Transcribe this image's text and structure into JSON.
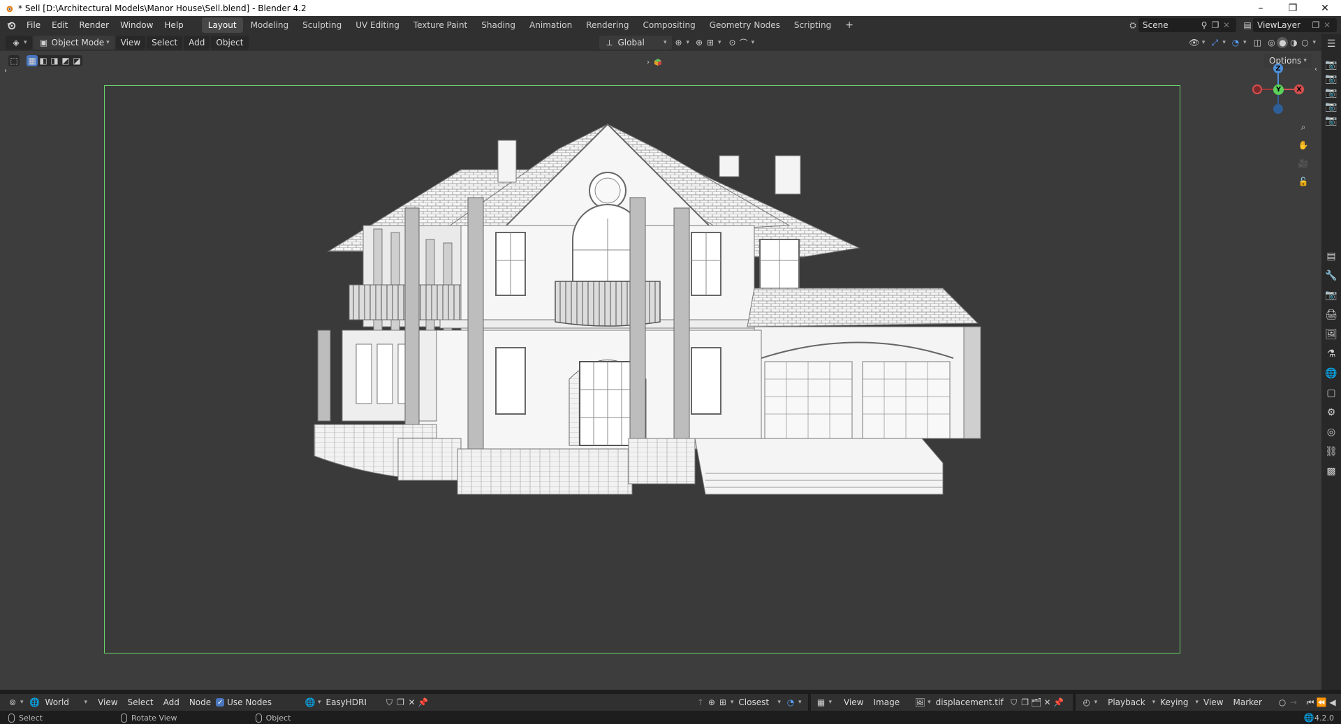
{
  "window": {
    "title": "* Sell [D:\\Architectural Models\\Manor House\\Sell.blend] - Blender 4.2",
    "minimize": "–",
    "restore": "❐",
    "close": "✕"
  },
  "menu": [
    "File",
    "Edit",
    "Render",
    "Window",
    "Help"
  ],
  "workspaces": [
    "Layout",
    "Modeling",
    "Sculpting",
    "UV Editing",
    "Texture Paint",
    "Shading",
    "Animation",
    "Rendering",
    "Compositing",
    "Geometry Nodes",
    "Scripting"
  ],
  "active_workspace": "Layout",
  "add_workspace": "+",
  "scene": {
    "label": "Scene"
  },
  "view_layer": {
    "label": "ViewLayer"
  },
  "viewport_header": {
    "mode": "Object Mode",
    "view": "View",
    "select": "Select",
    "add": "Add",
    "object": "Object",
    "orientation": "Global",
    "options": "Options"
  },
  "bottom": {
    "world_label": "World",
    "view": "View",
    "select": "Select",
    "add": "Add",
    "node": "Node",
    "use_nodes": "Use Nodes",
    "world_name": "EasyHDRI",
    "snap": "Closest",
    "image_view": "View",
    "image_menu": "Image",
    "image_name": "displacement.tif",
    "playback": "Playback",
    "keying": "Keying",
    "timeline_view": "View",
    "marker": "Marker"
  },
  "status": {
    "select": "Select",
    "rotate": "Rotate View",
    "object": "Object",
    "version": "4.2.0"
  },
  "gizmo": {
    "z": "Z",
    "y": "Y",
    "x": "X"
  },
  "colors": {
    "frame": "#6ad26a",
    "viewport": "#3d3d3d",
    "header": "#303030"
  }
}
